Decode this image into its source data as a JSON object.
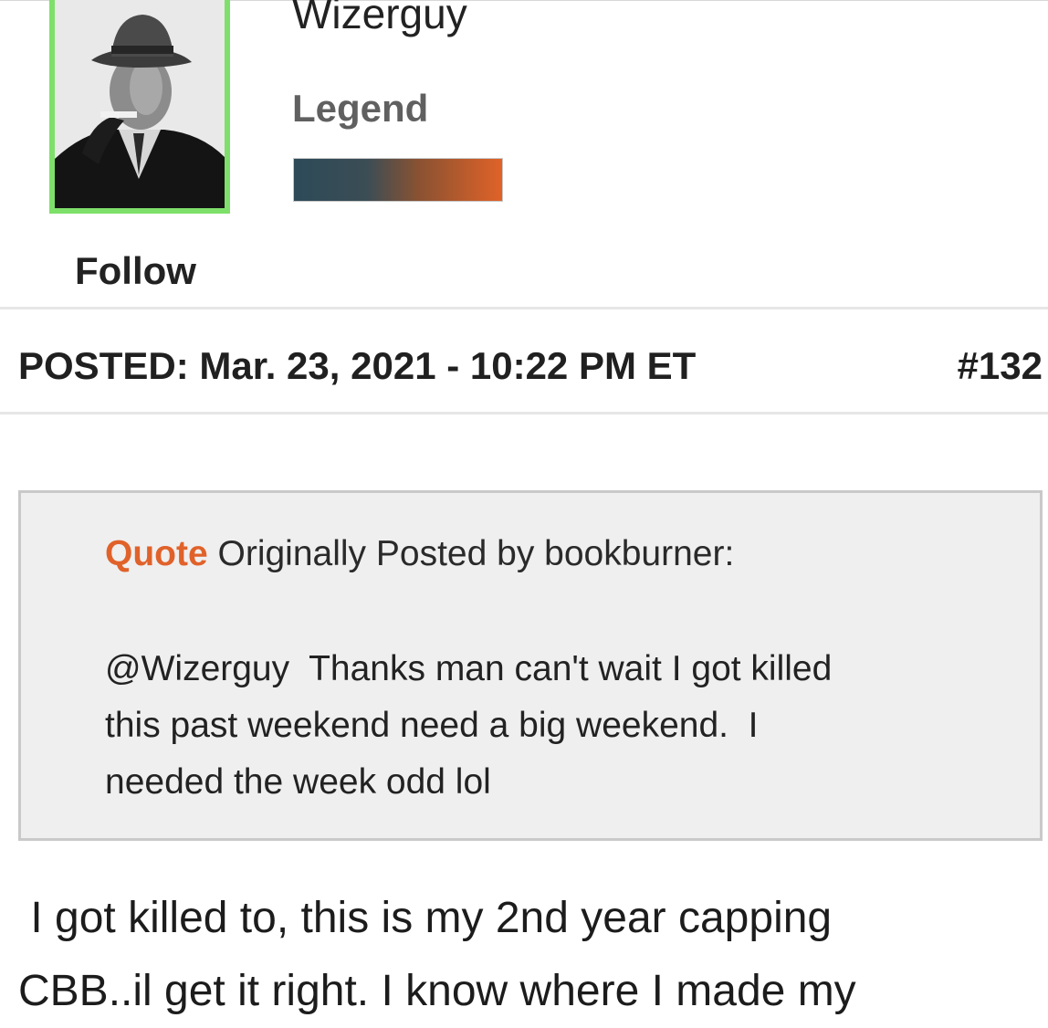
{
  "user": {
    "username": "Wizerguy",
    "rank": "Legend",
    "rank_progress_percent": 100,
    "follow_label": "Follow"
  },
  "post": {
    "posted_label": "POSTED: Mar. 23, 2021 - 10:22 PM ET",
    "post_number": "#132",
    "quote": {
      "label": "Quote",
      "attribution": " Originally Posted by bookburner:",
      "text": "@Wizerguy  Thanks man can't wait I got killed\nthis past weekend need a big weekend.  I\nneeded the week odd lol"
    },
    "body": " I got killed to, this is my 2nd year capping\nCBB..il get it right. I know where I made my"
  },
  "colors": {
    "avatar_border": "#7ee06a",
    "quote_label": "#e0622a",
    "rank_bar_start": "#2d4a58",
    "rank_bar_end": "#e06228"
  }
}
